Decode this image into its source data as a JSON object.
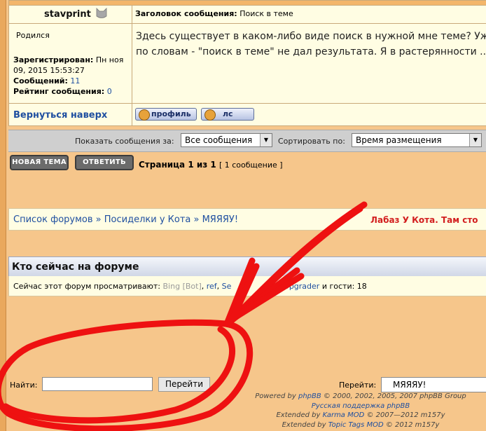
{
  "post": {
    "author": "stavprint",
    "subject_label": "Заголовок сообщения:",
    "subject_value": "Поиск в теме",
    "born_label": "Родился",
    "registered_label": "Зарегистрирован:",
    "registered_value": "Пн ноя 09, 2015 15:53:27",
    "messages_label": "Сообщений:",
    "messages_value": "11",
    "rating_label": "Рейтинг сообщения:",
    "rating_value": "0",
    "text_line1": "Здесь существует в каком-либо виде поиск в нужной мне теме? Уже",
    "text_line2": "по словам - \"поиск в теме\" не дал результата. Я в растерянности ...",
    "back_to_top": "Вернуться наверх",
    "profile_button": "профиль",
    "pm_button": "лс"
  },
  "sortbar": {
    "show_label": "Показать сообщения за:",
    "show_value": "Все сообщения",
    "sort_label": "Сортировать по:",
    "sort_value": "Время размещения"
  },
  "actions": {
    "new_topic": "НОВАЯ ТЕМА",
    "reply": "ОТВЕТИТЬ",
    "page_text": "Страница 1 из 1",
    "post_count": "[ 1 сообщение ]"
  },
  "breadcrumb": {
    "items": [
      "Список форумов",
      "Посиделки у Кота",
      "МЯЯЯУ!"
    ],
    "separator": " » ",
    "ad_text": "Лабаз У Кота. Там сто"
  },
  "online": {
    "title": "Кто сейчас на форуме",
    "prefix": "Сейчас этот форум просматривают:",
    "users": [
      "Bing [Bot]",
      "ref",
      "Se",
      "nk",
      "Upgrader"
    ],
    "guests_label": "и гости:",
    "guests_count": "18"
  },
  "footer": {
    "find_label": "Найти:",
    "find_value": "",
    "go_button": "Перейти",
    "jump_label": "Перейти:",
    "jump_value": "МЯЯЯУ!",
    "credit1_prefix": "Powered by",
    "credit1_link": "phpBB",
    "credit1_suffix": "© 2000, 2002, 2005, 2007 phpBB Group",
    "credit2": "Русская поддержка phpBB",
    "credit3_prefix": "Extended by",
    "credit3_link": "Karma MOD",
    "credit3_suffix": "© 2007—2012 m157y",
    "credit4_prefix": "Extended by",
    "credit4_link": "Topic Tags MOD",
    "credit4_suffix": "© 2012 m157y"
  },
  "colors": {
    "page_bg": "#f6c68b",
    "panel_bg": "#fffde3",
    "link": "#1f4fa0",
    "ad_red": "#d21e1e",
    "annotation_red": "#ee1111"
  }
}
